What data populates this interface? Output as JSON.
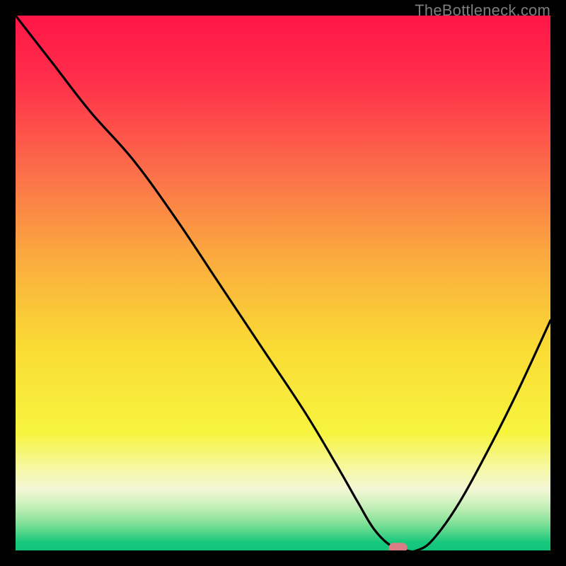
{
  "watermark": "TheBottleneck.com",
  "chart_data": {
    "type": "line",
    "title": "",
    "xlabel": "",
    "ylabel": "",
    "xlim": [
      0,
      100
    ],
    "ylim": [
      0,
      100
    ],
    "grid": false,
    "legend": false,
    "annotations": [],
    "series": [
      {
        "name": "bottleneck-curve",
        "x": [
          0,
          7,
          14,
          22,
          30,
          38,
          46,
          54,
          60,
          64,
          67,
          70,
          73,
          75,
          78,
          83,
          89,
          94,
          100
        ],
        "y": [
          100,
          91,
          82,
          73,
          62,
          50,
          38,
          26,
          16,
          9,
          4,
          1,
          0,
          0,
          2,
          9,
          20,
          30,
          43
        ]
      }
    ],
    "marker": {
      "name": "highlight-pill",
      "x": 71.5,
      "y": 0.5,
      "color": "#db7d84"
    },
    "gradient_stops": [
      {
        "offset": 0.0,
        "color": "#ff1647"
      },
      {
        "offset": 0.12,
        "color": "#ff2e4a"
      },
      {
        "offset": 0.28,
        "color": "#fc6a4a"
      },
      {
        "offset": 0.45,
        "color": "#fbaa3f"
      },
      {
        "offset": 0.62,
        "color": "#fadb34"
      },
      {
        "offset": 0.78,
        "color": "#f7f43e"
      },
      {
        "offset": 0.84,
        "color": "#f6f89a"
      },
      {
        "offset": 0.885,
        "color": "#f3f7d6"
      },
      {
        "offset": 0.905,
        "color": "#d9f3c5"
      },
      {
        "offset": 0.925,
        "color": "#b7ecb0"
      },
      {
        "offset": 0.945,
        "color": "#8be39b"
      },
      {
        "offset": 0.965,
        "color": "#55d68b"
      },
      {
        "offset": 0.985,
        "color": "#17c97d"
      },
      {
        "offset": 1.0,
        "color": "#10c47a"
      }
    ]
  }
}
